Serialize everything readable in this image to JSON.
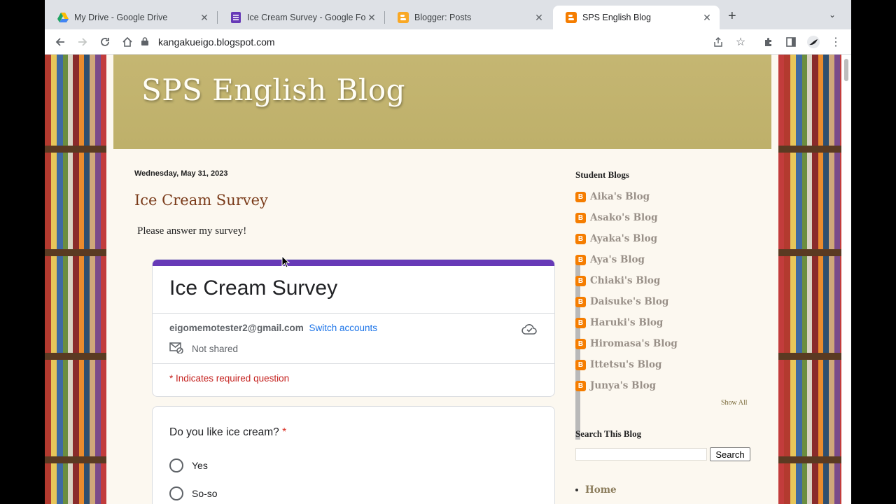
{
  "tabs": [
    {
      "title": "My Drive - Google Drive",
      "icon": "google-drive-icon"
    },
    {
      "title": "Ice Cream Survey - Google Forms",
      "icon": "google-forms-icon"
    },
    {
      "title": "Blogger: Posts",
      "icon": "blogger-icon"
    },
    {
      "title": "SPS English Blog",
      "icon": "blogger-icon",
      "active": true
    }
  ],
  "toolbar": {
    "url": "kangakueigo.blogspot.com"
  },
  "blog": {
    "title": "SPS English Blog",
    "post_date": "Wednesday, May 31, 2023",
    "post_title": "Ice Cream Survey",
    "post_text": "Please answer my survey!"
  },
  "form": {
    "title": "Ice Cream Survey",
    "email": "eigomemotester2@gmail.com",
    "switch_label": "Switch accounts",
    "not_shared": "Not shared",
    "required_note": "* Indicates required question",
    "question": "Do you like ice cream?",
    "required_star": "*",
    "options": [
      "Yes",
      "So-so"
    ],
    "accent_color": "#673ab7"
  },
  "sidebar": {
    "student_blogs_heading": "Student Blogs",
    "blogs": [
      "Aika's Blog",
      "Asako's Blog",
      "Ayaka's Blog",
      "Aya's Blog",
      "Chiaki's Blog",
      "Daisuke's Blog",
      "Haruki's Blog",
      "Hiromasa's Blog",
      "Ittetsu's Blog",
      "Junya's Blog"
    ],
    "show_all": "Show All",
    "search_heading": "Search This Blog",
    "search_button": "Search",
    "pages": [
      "Home"
    ]
  }
}
